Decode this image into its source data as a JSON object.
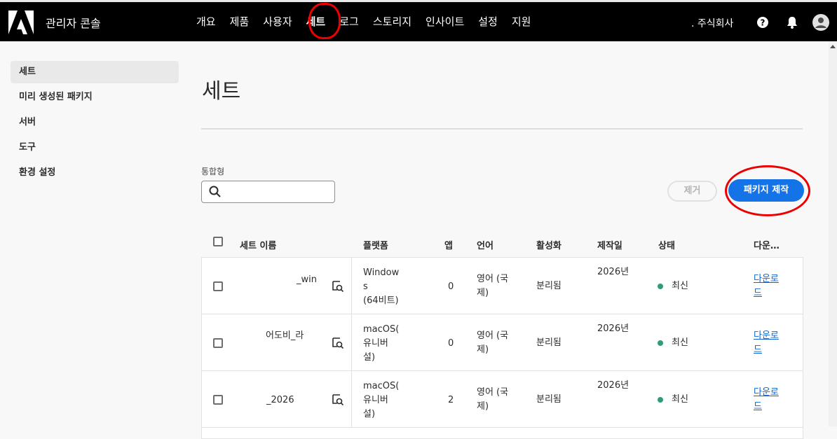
{
  "header": {
    "title": "관리자 콘솔",
    "nav": [
      "개요",
      "제품",
      "사용자",
      "세트",
      "로그",
      "스토리지",
      "인사이트",
      "설정",
      "지원"
    ],
    "active_nav": "세트",
    "org": ". 주식회사"
  },
  "sidebar": {
    "items": [
      "세트",
      "미리 생성된 패키지",
      "서버",
      "도구",
      "환경 설정"
    ]
  },
  "main": {
    "title": "세트",
    "search_label": "통합형",
    "search_placeholder": "",
    "remove_label": "제거",
    "create_label": "패키지 제작"
  },
  "table": {
    "headers": [
      "세트 이름",
      "플랫폼",
      "앱",
      "언어",
      "활성화",
      "제작일",
      "상태",
      "다운…"
    ],
    "rows": [
      {
        "name": "_win",
        "platform": [
          "Window",
          "s",
          "(64비트)"
        ],
        "apps": "0",
        "language": [
          "영어 (국",
          "제)"
        ],
        "activation": "분리됨",
        "created": [
          "2026년"
        ],
        "status": "최신",
        "download": [
          "다운로",
          "드"
        ]
      },
      {
        "name": "어도비_라",
        "platform": [
          "macOS(",
          "유니버",
          "설)"
        ],
        "apps": "0",
        "language": [
          "영어 (국",
          "제)"
        ],
        "activation": "분리됨",
        "created": [
          "2026년"
        ],
        "status": "최신",
        "download": [
          "다운로",
          "드"
        ]
      },
      {
        "name": "_2026",
        "platform": [
          "macOS(",
          "유니버",
          "설)"
        ],
        "apps": "2",
        "language": [
          "영어 (국",
          "제)"
        ],
        "activation": "분리됨",
        "created": [
          "2026년"
        ],
        "status": "최신",
        "download": [
          "다운로",
          "드"
        ]
      }
    ]
  },
  "colors": {
    "accent": "#1473e6",
    "status_current": "#2d9d78",
    "annotation": "#e00000"
  }
}
